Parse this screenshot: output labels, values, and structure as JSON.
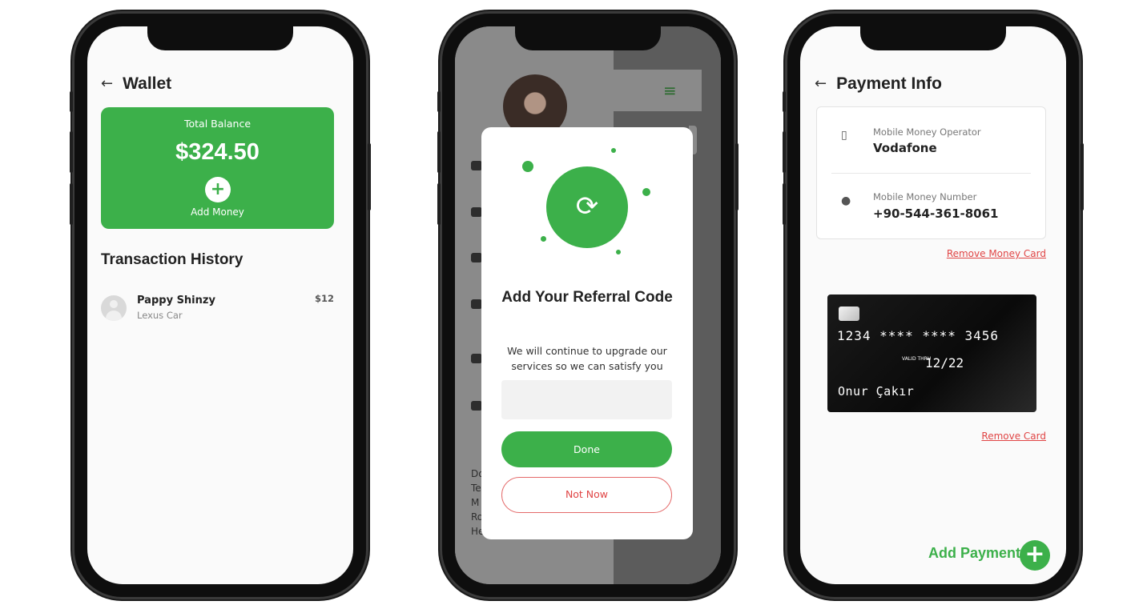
{
  "wallet": {
    "title": "Wallet",
    "back_icon": "arrow-left-icon",
    "balance_label": "Total Balance",
    "balance_amount": "$324.50",
    "add_icon": "plus-icon",
    "add_money_label": "Add Money",
    "history_title": "Transaction History",
    "transactions": [
      {
        "name": "Pappy Shinzy",
        "subtitle": "Lexus Car",
        "amount": "$12",
        "avatar_icon": "user-avatar-icon"
      }
    ]
  },
  "referral": {
    "icon": "refresh-icon",
    "title": "Add Your Referral Code",
    "description": "We will continue to upgrade our services so we can satisfy you",
    "input_value": "",
    "done_label": "Done",
    "not_now_label": "Not Now",
    "background": {
      "menu_icon": "hamburger-menu-icon",
      "text_lines": [
        "Do",
        "Te",
        "M",
        "Ro",
        "He"
      ]
    }
  },
  "payment": {
    "title": "Payment Info",
    "back_icon": "arrow-left-icon",
    "operator_label": "Mobile Money Operator",
    "operator_value": "Vodafone",
    "number_label": "Mobile Money Number",
    "number_value": "+90-544-361-8061",
    "remove_money_card": "Remove Money Card",
    "card": {
      "number": "1234 **** **** 3456",
      "valid_thru_label": "VALID THRU",
      "expiry": "12/22",
      "holder": "Onur Çakır"
    },
    "remove_card": "Remove Card",
    "add_payment": "Add Payment",
    "add_payment_icon": "plus-icon"
  },
  "colors": {
    "brand_green": "#3cb04a",
    "danger_red": "#e04545"
  }
}
